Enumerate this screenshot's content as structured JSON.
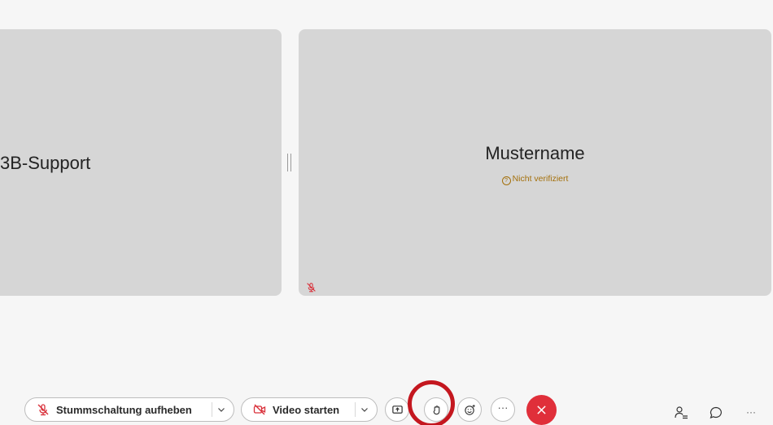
{
  "tiles": {
    "left": {
      "name": "3B-Support"
    },
    "right": {
      "name": "Mustername",
      "status": "Nicht verifiziert",
      "status_icon": "question-circle-icon"
    }
  },
  "toolbar": {
    "unmute_label": "Stummschaltung aufheben",
    "video_label": "Video starten",
    "share_icon": "share-screen-icon",
    "hand_icon": "raise-hand-icon",
    "reactions_icon": "reactions-icon",
    "more_label": "···",
    "end_icon": "close-icon"
  },
  "side_actions": {
    "participants_icon": "participants-icon",
    "chat_icon": "chat-icon",
    "overflow_label": "···"
  },
  "colors": {
    "muted_red": "#d9303a",
    "end_call_red": "#e02f3a",
    "warning_amber": "#a4700b",
    "highlight_ring": "#c4171f",
    "tile_gray": "#d6d6d6",
    "background": "#f6f6f6"
  }
}
